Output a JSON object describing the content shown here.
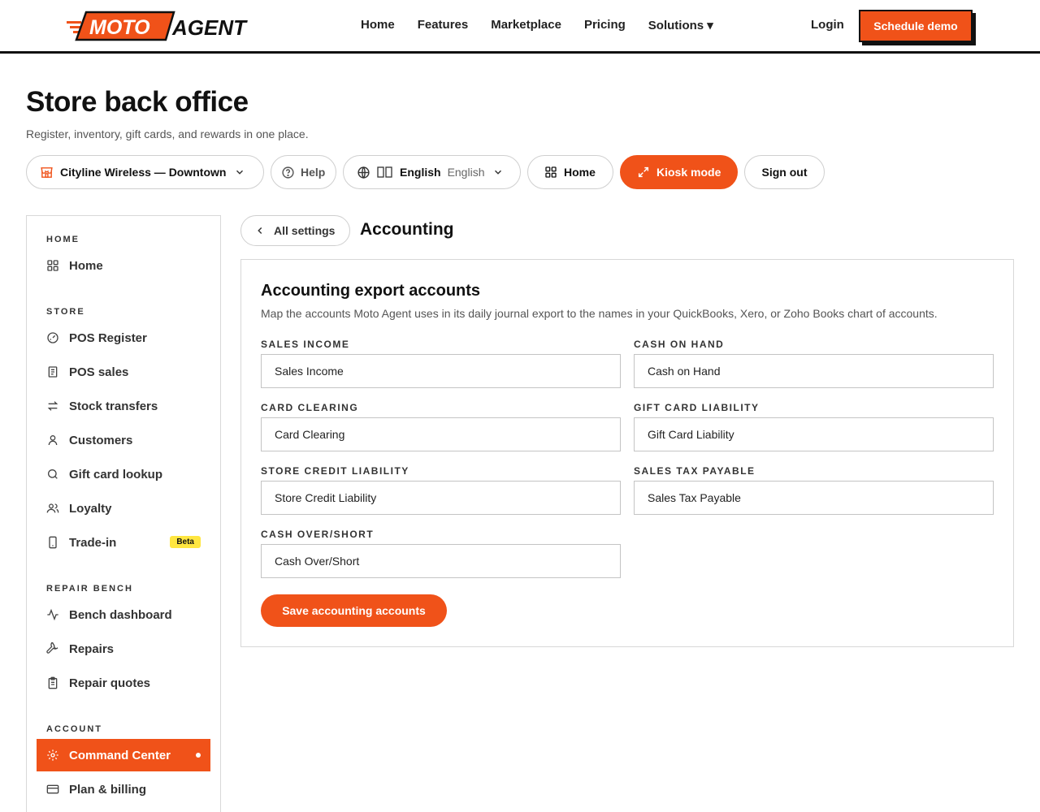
{
  "header": {
    "logo_text_1": "MOTO",
    "logo_text_2": "AGENT",
    "nav": [
      "Home",
      "Features",
      "Marketplace",
      "Pricing",
      "Solutions ▾"
    ],
    "login": "Login",
    "cta": "Schedule demo"
  },
  "page": {
    "title": "Store back office",
    "subtitle": "Register, inventory, gift cards, and rewards in one place."
  },
  "toolbar": {
    "store": "Cityline Wireless — Downtown",
    "help": "Help",
    "lang_native": "English",
    "lang_english": "English",
    "home": "Home",
    "kiosk": "Kiosk mode",
    "signout": "Sign out"
  },
  "sidebar": {
    "sections": {
      "home": "HOME",
      "store": "STORE",
      "repair": "REPAIR BENCH",
      "account": "ACCOUNT"
    },
    "items": {
      "home": "Home",
      "pos_register": "POS Register",
      "pos_sales": "POS sales",
      "stock_transfers": "Stock transfers",
      "customers": "Customers",
      "gift_card_lookup": "Gift card lookup",
      "loyalty": "Loyalty",
      "trade_in": "Trade-in",
      "trade_in_badge": "Beta",
      "bench_dashboard": "Bench dashboard",
      "repairs": "Repairs",
      "repair_quotes": "Repair quotes",
      "command_center": "Command Center",
      "plan_billing": "Plan & billing"
    }
  },
  "main": {
    "back": "All settings",
    "section_title": "Accounting",
    "card_title": "Accounting export accounts",
    "card_desc": "Map the accounts Moto Agent uses in its daily journal export to the names in your QuickBooks, Xero, or Zoho Books chart of accounts.",
    "fields": {
      "sales_income": {
        "label": "SALES INCOME",
        "value": "Sales Income"
      },
      "cash_on_hand": {
        "label": "CASH ON HAND",
        "value": "Cash on Hand"
      },
      "card_clearing": {
        "label": "CARD CLEARING",
        "value": "Card Clearing"
      },
      "gift_card_liability": {
        "label": "GIFT CARD LIABILITY",
        "value": "Gift Card Liability"
      },
      "store_credit_liability": {
        "label": "STORE CREDIT LIABILITY",
        "value": "Store Credit Liability"
      },
      "sales_tax_payable": {
        "label": "SALES TAX PAYABLE",
        "value": "Sales Tax Payable"
      },
      "cash_over_short": {
        "label": "CASH OVER/SHORT",
        "value": "Cash Over/Short"
      }
    },
    "save": "Save accounting accounts"
  },
  "colors": {
    "accent": "#f05219",
    "badge": "#ffe640",
    "text": "#111111"
  }
}
